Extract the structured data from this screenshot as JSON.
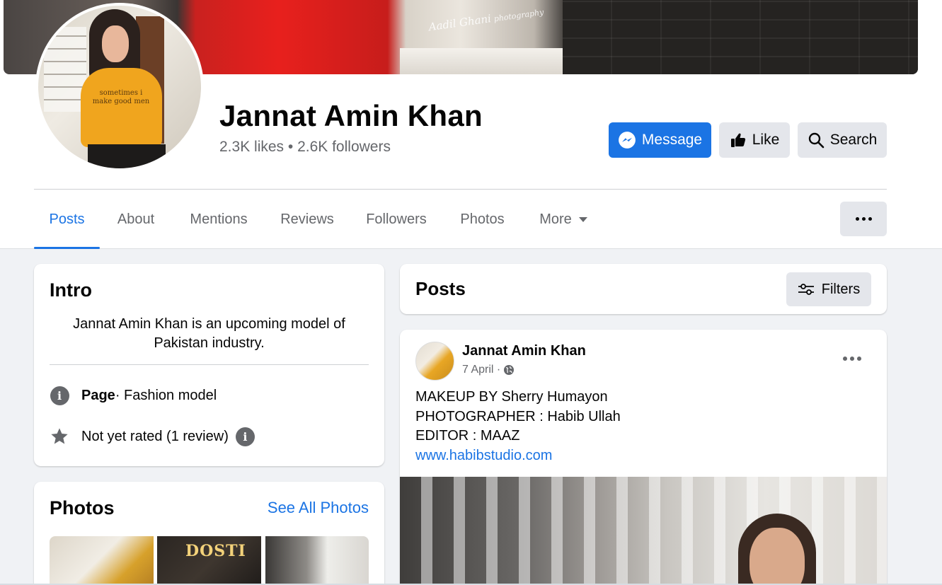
{
  "cover": {
    "watermark": "Aadil Ghani",
    "watermark_sub": "photography"
  },
  "profile": {
    "name": "Jannat Amin Khan",
    "stats": "2.3K likes • 2.6K followers",
    "avatar_shirt_text": "sometimes i make good men"
  },
  "actions": {
    "message": "Message",
    "like": "Like",
    "search": "Search"
  },
  "tabs": [
    {
      "label": "Posts",
      "active": true
    },
    {
      "label": "About"
    },
    {
      "label": "Mentions"
    },
    {
      "label": "Reviews"
    },
    {
      "label": "Followers"
    },
    {
      "label": "Photos"
    },
    {
      "label": "More"
    }
  ],
  "intro": {
    "title": "Intro",
    "bio": "Jannat Amin Khan is an upcoming model of Pakistan industry.",
    "page_label": "Page",
    "page_category": " · Fashion model",
    "rating": "Not yet rated (1 review)"
  },
  "photos": {
    "title": "Photos",
    "see_all": "See All Photos",
    "thumb2_text": "DOSTI"
  },
  "posts_header": {
    "title": "Posts",
    "filters": "Filters"
  },
  "post": {
    "author": "Jannat Amin Khan",
    "date": "7 April ·",
    "lines": [
      "MAKEUP BY Sherry Humayon",
      "PHOTOGRAPHER : Habib Ullah",
      "EDITOR : MAAZ"
    ],
    "link": "www.habibstudio.com"
  },
  "colors": {
    "accent": "#1b74e4",
    "background": "#f0f2f5",
    "secondary_text": "#65676b"
  }
}
